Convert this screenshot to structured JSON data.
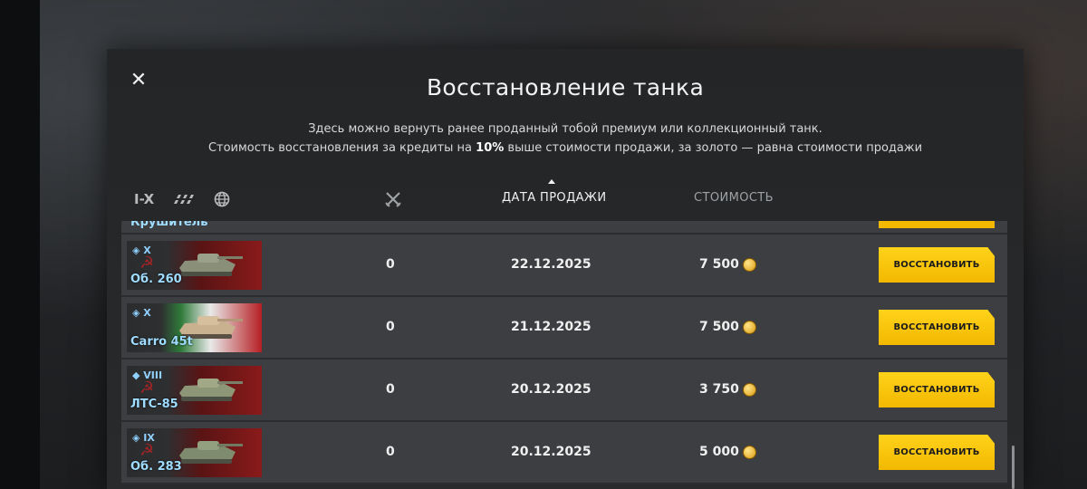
{
  "modal": {
    "title": "Восстановление танка",
    "description_line1": "Здесь можно вернуть ранее проданный тобой премиум или коллекционный танк.",
    "description_line2_pre": "Стоимость восстановления за кредиты на ",
    "description_line2_bold": "10%",
    "description_line2_post": " выше стоимости продажи, за золото — равна стоимости продажи"
  },
  "filters": {
    "tier_label": "I-X",
    "type_icon": "tank-type-icon",
    "nation_icon": "globe-icon"
  },
  "columns": {
    "kills_icon": "crossed-swords-icon",
    "date": "ДАТА ПРОДАЖИ",
    "cost": "СТОИМОСТЬ"
  },
  "partial_row": {
    "name": "Крушитель"
  },
  "rows": [
    {
      "tier": "X",
      "name": "Об. 260",
      "nation": "ussr",
      "kills": "0",
      "date": "22.12.2025",
      "cost": "7 500",
      "button": "ВОССТАНОВИТЬ"
    },
    {
      "tier": "X",
      "name": "Carro 45t",
      "nation": "italy",
      "kills": "0",
      "date": "21.12.2025",
      "cost": "7 500",
      "button": "ВОССТАНОВИТЬ"
    },
    {
      "tier": "VIII",
      "name": "ЛТС-85",
      "nation": "ussr",
      "kills": "0",
      "date": "20.12.2025",
      "cost": "3 750",
      "button": "ВОССТАНОВИТЬ"
    },
    {
      "tier": "IX",
      "name": "Об. 283",
      "nation": "ussr",
      "kills": "0",
      "date": "20.12.2025",
      "cost": "5 000",
      "button": "ВОССТАНОВИТЬ"
    }
  ],
  "colors": {
    "accent": "#f3b800",
    "tank_name": "#9fdcff"
  }
}
